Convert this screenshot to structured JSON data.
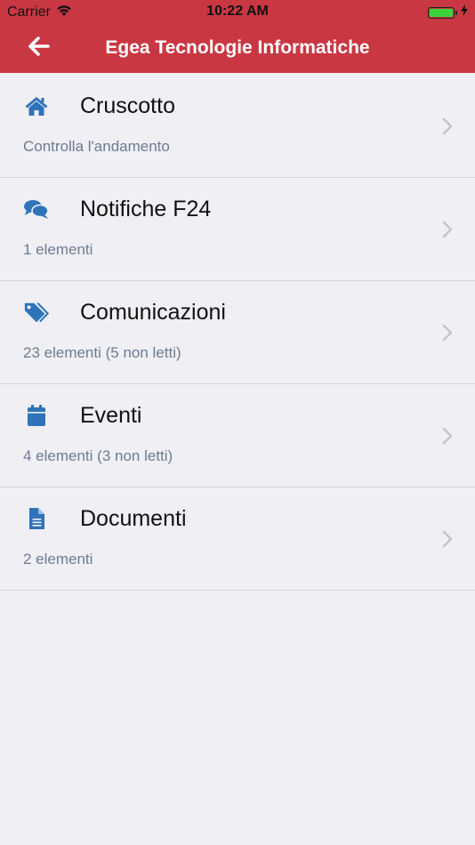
{
  "status_bar": {
    "carrier": "Carrier",
    "time": "10:22 AM",
    "battery_level": 1.0
  },
  "header": {
    "title": "Egea Tecnologie Informatiche",
    "background_color": "#c93743",
    "back_icon": "arrow-left-icon"
  },
  "colors": {
    "icon_blue": "#2f73b9",
    "subtitle": "#6e7c91",
    "background": "#efeff4"
  },
  "menu": {
    "items": [
      {
        "title": "Cruscotto",
        "subtitle": "Controlla l'andamento",
        "icon": "home-icon"
      },
      {
        "title": "Notifiche F24",
        "subtitle": "1 elementi",
        "icon": "comments-icon"
      },
      {
        "title": "Comunicazioni",
        "subtitle": "23 elementi (5 non letti)",
        "icon": "tags-icon"
      },
      {
        "title": "Eventi",
        "subtitle": "4 elementi (3 non letti)",
        "icon": "calendar-icon"
      },
      {
        "title": "Documenti",
        "subtitle": "2 elementi",
        "icon": "document-icon"
      }
    ]
  }
}
